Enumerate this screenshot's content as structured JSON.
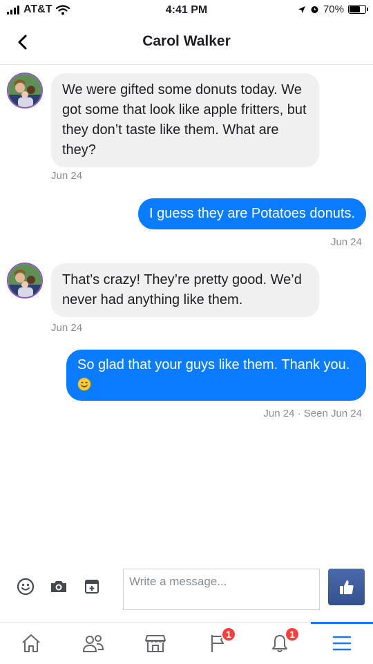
{
  "status_bar": {
    "carrier": "AT&T",
    "time": "4:41 PM",
    "battery_percent": "70%",
    "battery_level": 0.7,
    "icons": [
      "signal-icon",
      "wifi-icon",
      "location-icon",
      "alarm-icon",
      "battery-icon"
    ]
  },
  "header": {
    "title": "Carol Walker",
    "back_icon": "chevron-left-icon"
  },
  "conversation": {
    "messages": [
      {
        "direction": "incoming",
        "text": "We were gifted some donuts today. We got some that look like apple fritters, but they don’t taste like them. What are they?",
        "timestamp": "Jun 24"
      },
      {
        "direction": "outgoing",
        "text": "I guess they are Potatoes donuts.",
        "timestamp": "Jun 24"
      },
      {
        "direction": "incoming",
        "text": "That’s crazy! They’re pretty good. We’d never had anything like them.",
        "timestamp": "Jun 24"
      },
      {
        "direction": "outgoing",
        "text": "So glad that your guys like them. Thank you.",
        "emoji": "smiling-face-emoji",
        "timestamp": "Jun 24 · Seen Jun 24"
      }
    ]
  },
  "composer": {
    "placeholder": "Write a message...",
    "value": "",
    "icons": [
      "emoji-icon",
      "camera-icon",
      "sticker-icon"
    ],
    "send_icon": "thumbs-up-icon"
  },
  "tab_bar": {
    "tabs": [
      {
        "icon": "home-icon"
      },
      {
        "icon": "friends-icon"
      },
      {
        "icon": "marketplace-icon"
      },
      {
        "icon": "flag-icon",
        "badge": "1"
      },
      {
        "icon": "bell-icon",
        "badge": "1"
      },
      {
        "icon": "menu-icon",
        "active": true
      }
    ]
  },
  "colors": {
    "outgoing_bubble": "#0a7cff",
    "incoming_bubble": "#f1f0f0",
    "timestamp": "#8a8d91",
    "badge": "#fa3e3e",
    "active_tab": "#1877f2",
    "like_button": "#3b5998"
  }
}
